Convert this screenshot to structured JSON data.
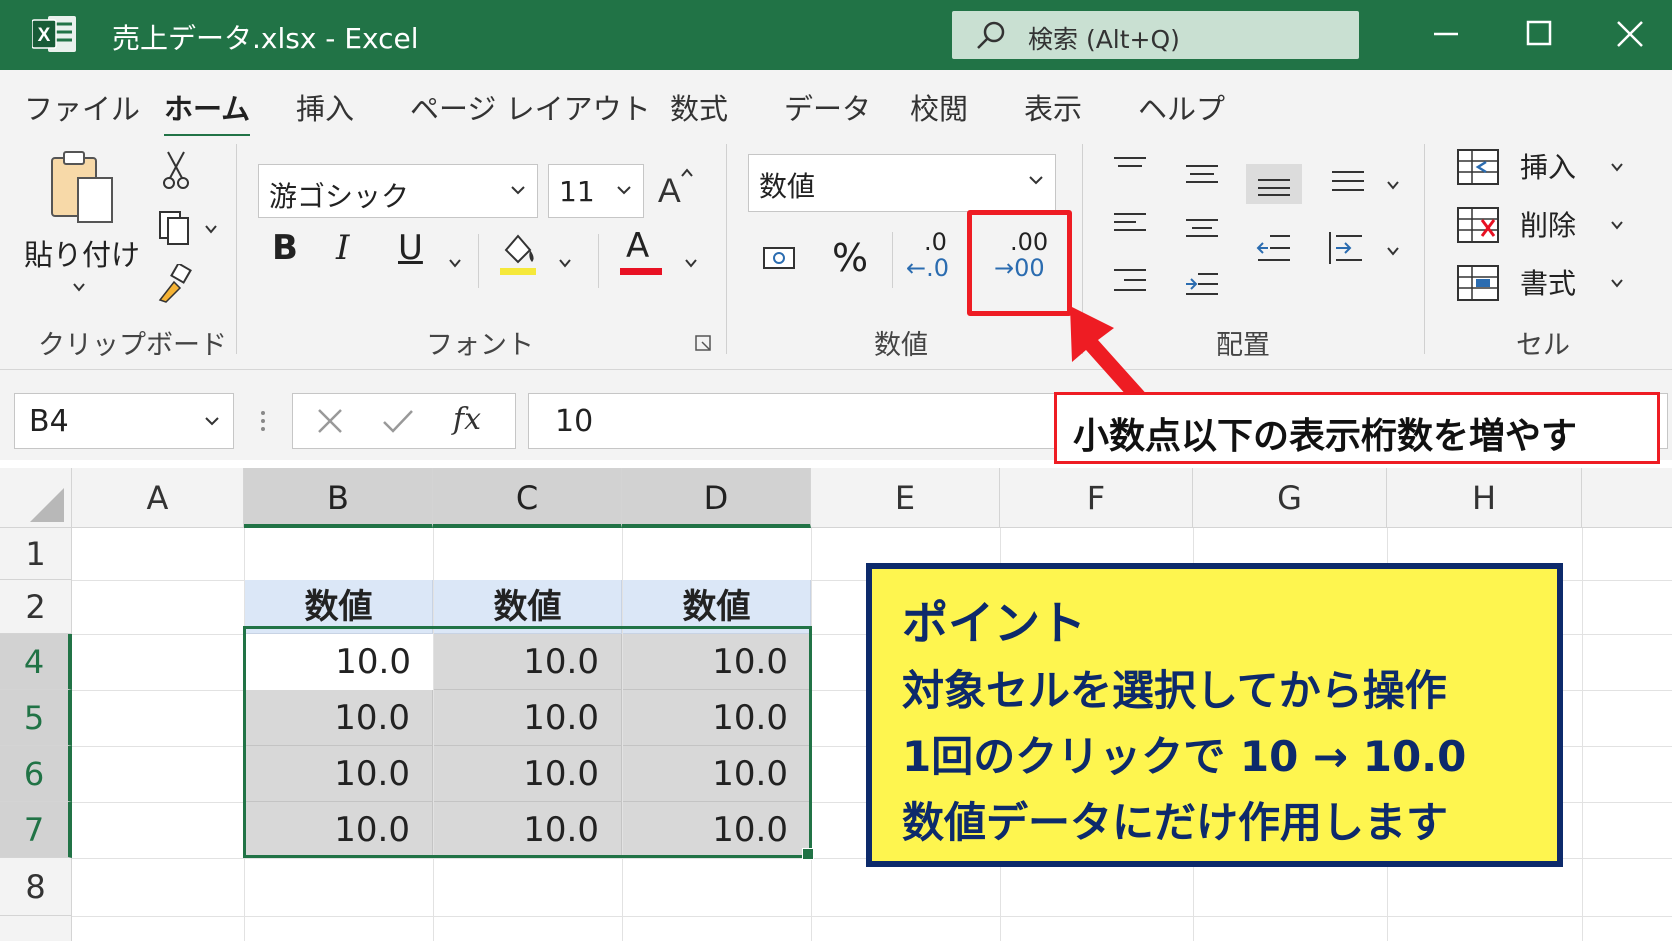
{
  "window": {
    "title": "売上データ.xlsx  -  Excel",
    "search_placeholder": "検索 (Alt+Q)",
    "theme_color": "#217346"
  },
  "tabs": [
    "ファイル",
    "ホーム",
    "挿入",
    "ページ レイアウト",
    "数式",
    "データ",
    "校閲",
    "表示",
    "ヘルプ"
  ],
  "active_tab": "ホーム",
  "ribbon": {
    "clipboard": {
      "paste_label": "貼り付け",
      "group_label": "クリップボード"
    },
    "font": {
      "font_name": "游ゴシック",
      "font_size": "11",
      "bold": "B",
      "italic": "I",
      "underline": "U",
      "font_color_letter": "A",
      "group_label": "フォント",
      "highlight_color": "#f5e83a",
      "font_color": "#e81123"
    },
    "number": {
      "format": "数値",
      "percent": "%",
      "decrease_top": ".0",
      "decrease_bottom": "←.0",
      "increase_top": ".00",
      "increase_bottom": "→00",
      "group_label": "数値"
    },
    "alignment": {
      "group_label": "配置"
    },
    "cells": {
      "insert_label": "挿入",
      "delete_label": "削除",
      "format_label": "書式",
      "group_label": "セル"
    }
  },
  "formula_bar": {
    "name_box": "B4",
    "fx_label": "fx",
    "formula": "10"
  },
  "sheet": {
    "columns": [
      "A",
      "B",
      "C",
      "D",
      "E",
      "F",
      "G",
      "H"
    ],
    "rows": [
      "1",
      "2",
      "4",
      "5",
      "6",
      "7",
      "8"
    ],
    "header_row": [
      "数値",
      "数値",
      "数値"
    ],
    "data": [
      [
        "10.0",
        "10.0",
        "10.0"
      ],
      [
        "10.0",
        "10.0",
        "10.0"
      ],
      [
        "10.0",
        "10.0",
        "10.0"
      ],
      [
        "10.0",
        "10.0",
        "10.0"
      ]
    ],
    "active_cell": "B4"
  },
  "annotations": {
    "callout": "小数点以下の表示桁数を増やす",
    "callout_color": "#ee1c23",
    "point": {
      "title": "ポイント",
      "lines": [
        "対象セルを選択してから操作",
        "1回のクリックで 10 → 10.0",
        "数値データにだけ作用します"
      ],
      "bg_color": "#fef54f",
      "text_color": "#0d2a6b"
    }
  }
}
